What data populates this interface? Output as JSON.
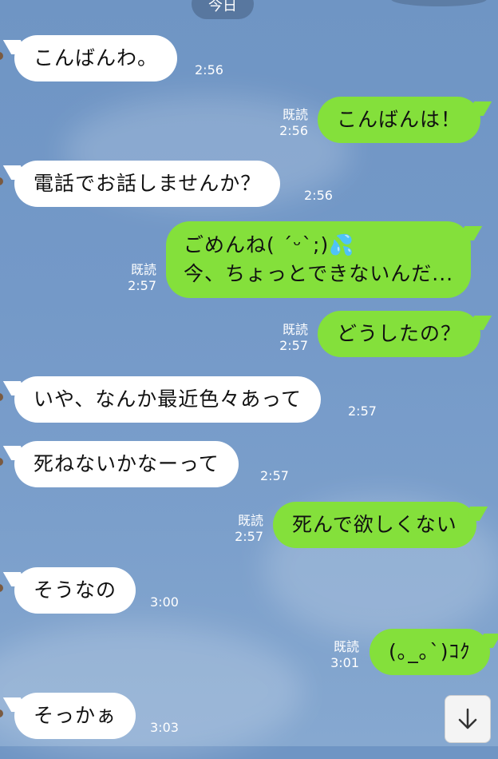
{
  "date_label": "今日",
  "messages": [
    {
      "dir": "in",
      "text": "こんばんわ。",
      "time": "2:56",
      "read": ""
    },
    {
      "dir": "out",
      "text": "こんばんは！",
      "time": "2:56",
      "read": "既読"
    },
    {
      "dir": "in",
      "text": "電話でお話しませんか？",
      "time": "2:56",
      "read": ""
    },
    {
      "dir": "out",
      "lines": [
        "ごめんね( ´ᵕ`;)💦",
        "今、ちょっとできないんだ..."
      ],
      "time": "2:57",
      "read": "既読"
    },
    {
      "dir": "out",
      "text": "どうしたの？",
      "time": "2:57",
      "read": "既読"
    },
    {
      "dir": "in",
      "text": "いや、なんか最近色々あって",
      "time": "2:57",
      "read": ""
    },
    {
      "dir": "in",
      "text": "死ねないかなーって",
      "time": "2:57",
      "read": ""
    },
    {
      "dir": "out",
      "text": "死んで欲しくない",
      "time": "2:57",
      "read": "既読"
    },
    {
      "dir": "in",
      "text": "そうなの",
      "time": "3:00",
      "read": ""
    },
    {
      "dir": "out",
      "text": "(｡_｡`)ｺｸ",
      "time": "3:01",
      "read": "既読"
    },
    {
      "dir": "in",
      "text": "そっかぁ",
      "time": "3:03",
      "read": ""
    }
  ],
  "scroll_button": {
    "icon": "arrow-down-icon"
  }
}
